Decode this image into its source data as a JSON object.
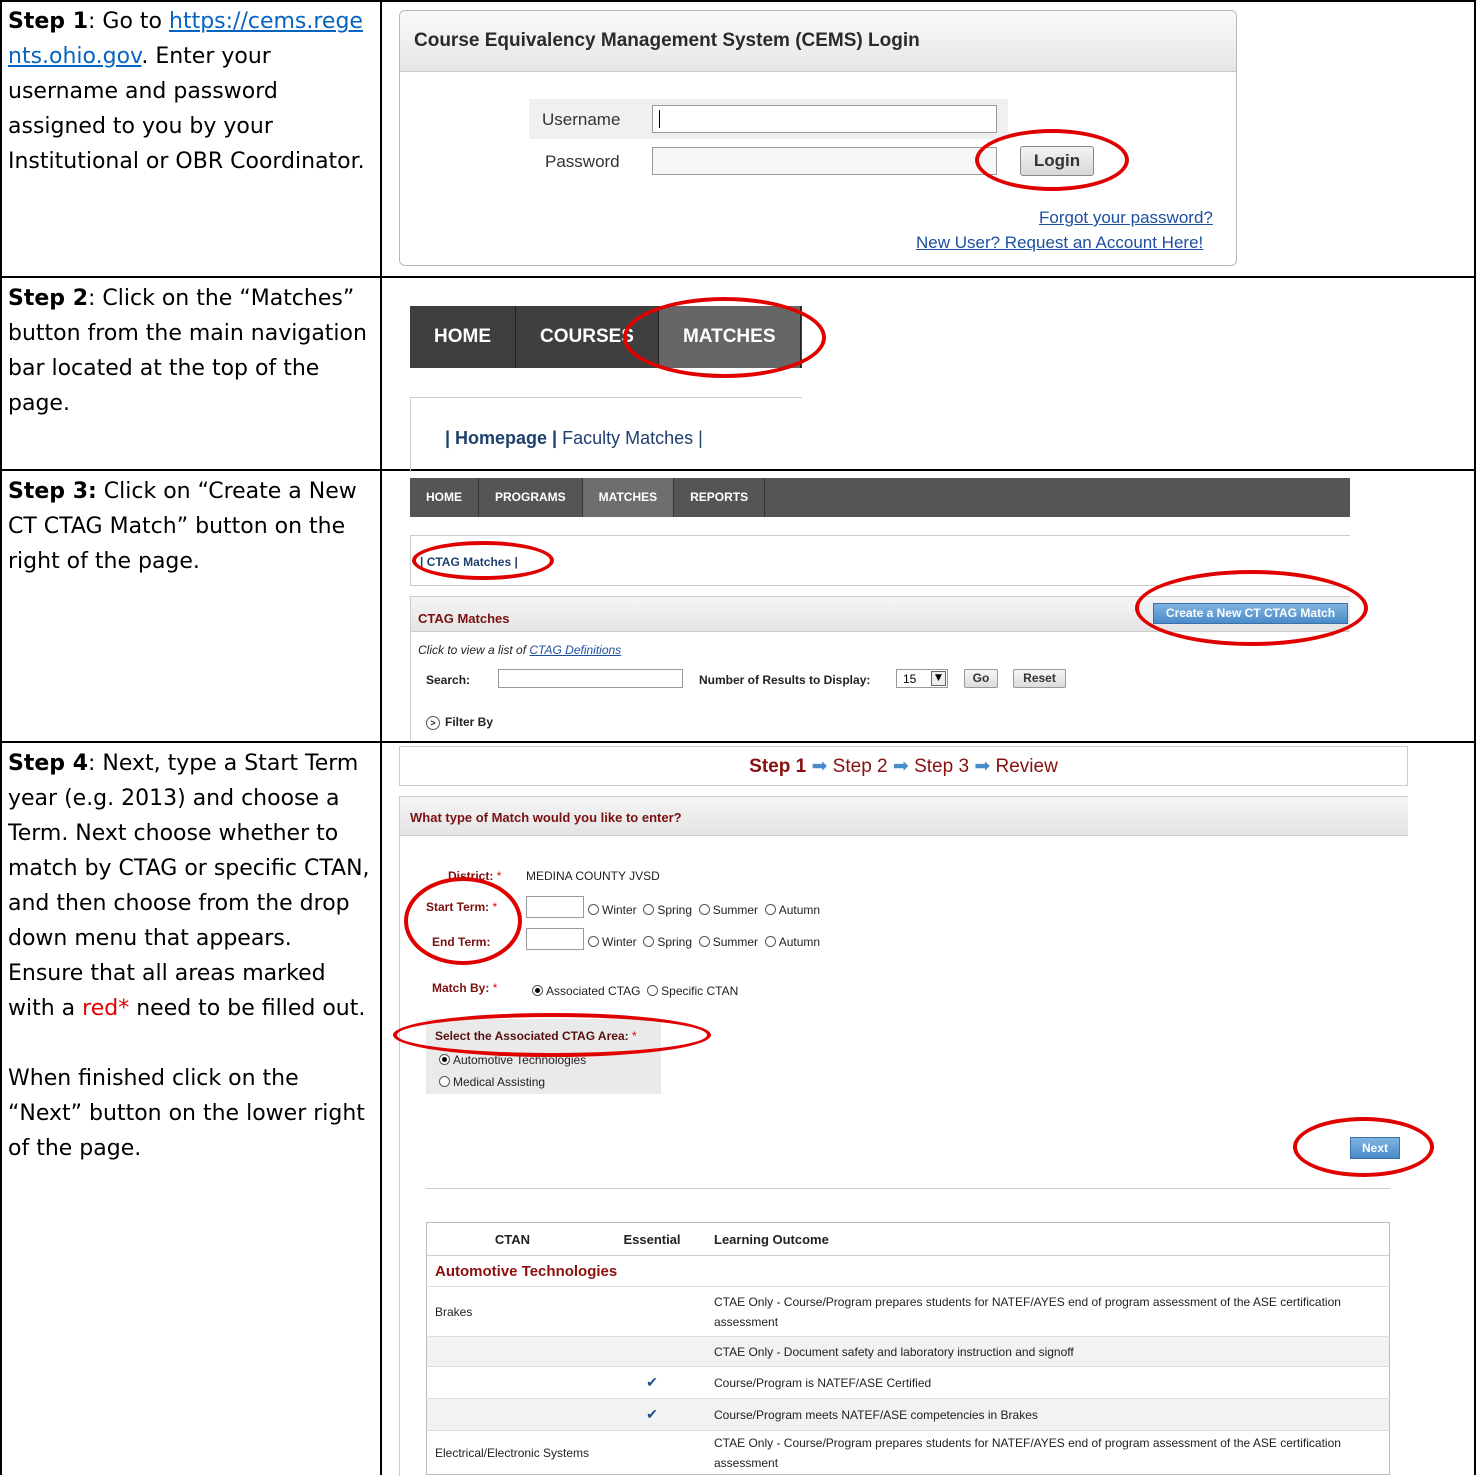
{
  "steps": [
    {
      "label": "Step 1",
      "text_a": ":  Go to ",
      "link": "https://cems.regents.ohio.gov",
      "text_b": ". Enter your username and password assigned to you by your Institutional or OBR Coordinator."
    },
    {
      "label": "Step 2",
      "text": ": Click on the “Matches” button from the main navigation bar located at the top of the page."
    },
    {
      "label": "Step 3:",
      "text": " Click on  “Create a New CT CTAG Match” button on the right of the page."
    },
    {
      "label": "Step 4",
      "text_a": ": Next, type a Start Term year (e.g. 2013) and choose a Term.   Next choose whether to match by CTAG or specific CTAN, and then choose from the drop down menu that appears.  Ensure that all areas marked with a ",
      "red_text": "red*",
      "text_b": " need to be filled out.",
      "text_c": "When finished click on the “Next” button on the lower right of the page."
    }
  ],
  "login": {
    "title": "Course Equivalency Management System (CEMS) Login",
    "username_label": "Username",
    "password_label": "Password",
    "button": "Login",
    "forgot": "Forgot your password?",
    "new_user": "New User? Request an Account Here!"
  },
  "nav2": {
    "items": [
      "HOME",
      "COURSES",
      "MATCHES"
    ],
    "sub_bold": "| Homepage |",
    "sub_link": "Faculty Matches |"
  },
  "nav3": {
    "items": [
      "HOME",
      "PROGRAMS",
      "MATCHES",
      "REPORTS"
    ],
    "crumb": "| CTAG Matches |",
    "title": "CTAG Matches",
    "create_button": "Create a New CT CTAG Match",
    "definitions_prefix": "Click to view a list of ",
    "definitions_link": "CTAG Definitions",
    "search_label": "Search:",
    "results_label": "Number of Results to Display:",
    "results_value": "15",
    "go": "Go",
    "reset": "Reset",
    "filter": "Filter By"
  },
  "wizard": {
    "step1": "Step 1",
    "step2": "Step 2",
    "step3": "Step 3",
    "review": "Review",
    "arrow": "➡"
  },
  "form4": {
    "title": "What type of Match would you like to enter?",
    "district_label": "District:",
    "district_value": "MEDINA COUNTY JVSD",
    "start_label": "Start Term:",
    "end_label": "End Term:",
    "terms": [
      "Winter",
      "Spring",
      "Summer",
      "Autumn"
    ],
    "matchby_label": "Match By:",
    "matchby_options": [
      "Associated CTAG",
      "Specific CTAN"
    ],
    "ctag_label": "Select the Associated CTAG Area:",
    "ctag_options": [
      "Automotive Technologies",
      "Medical Assisting"
    ],
    "req": "*",
    "next": "Next"
  },
  "table": {
    "headers": [
      "CTAN",
      "Essential",
      "Learning Outcome"
    ],
    "group": "Automotive Technologies",
    "rows": [
      {
        "ctan": "Brakes",
        "essential": "",
        "outcome": "CTAE Only - Course/Program prepares students for NATEF/AYES end of program assessment of the ASE certification assessment"
      },
      {
        "ctan": "",
        "essential": "",
        "outcome": "CTAE Only - Document safety and laboratory instruction and signoff"
      },
      {
        "ctan": "",
        "essential": "✔",
        "outcome": "Course/Program is NATEF/ASE Certified"
      },
      {
        "ctan": "",
        "essential": "✔",
        "outcome": "Course/Program meets NATEF/ASE competencies in Brakes"
      },
      {
        "ctan": "Electrical/Electronic Systems",
        "essential": "",
        "outcome": "CTAE Only - Course/Program prepares students for NATEF/AYES end of program assessment of the ASE certification assessment"
      }
    ]
  },
  "colors": {
    "annotation_red": "#e00000",
    "link_blue": "#0563c1",
    "header_maroon": "#7a1010"
  }
}
